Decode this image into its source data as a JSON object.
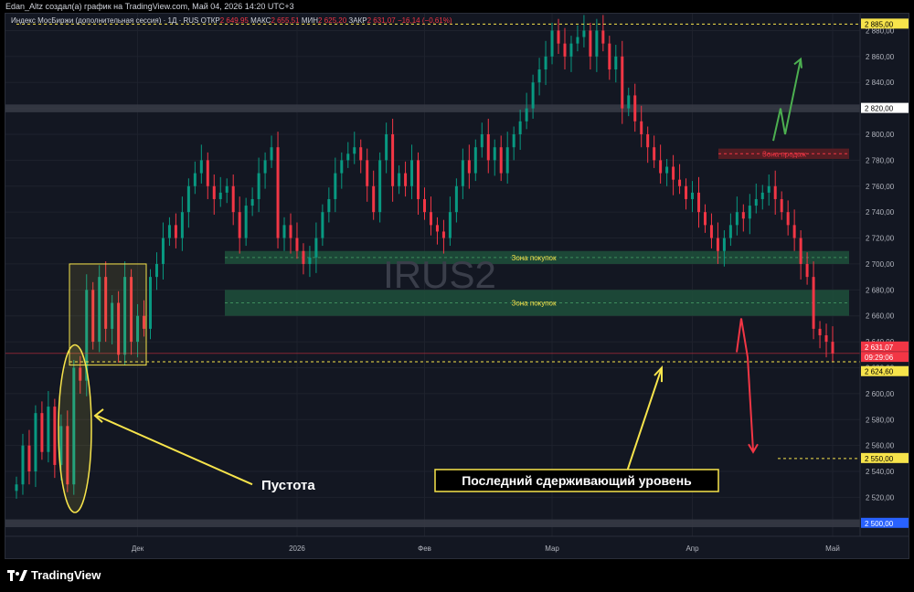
{
  "header": {
    "text": "Edan_Altz создал(а) график на TradingView.com, Май 04, 2026 14:20 UTC+3"
  },
  "legend": {
    "title": "Индекс МосБиржи (дополнительная сессия) · 1Д · RUS",
    "o_label": "ОТКР",
    "o_value": "2 649,95",
    "h_label": "МАКС",
    "h_value": "2 655,51",
    "l_label": "МИН",
    "l_value": "2 625,20",
    "c_label": "ЗАКР",
    "c_value": "2 631,07",
    "change": "−16,14 (−0,61%)"
  },
  "footer": {
    "brand": "TradingView"
  },
  "chart_data": {
    "type": "candlestick",
    "watermark": "IRUS2",
    "y_range": [
      2490,
      2893
    ],
    "y_ticks": [
      "2 880,00",
      "2 860,00",
      "2 840,00",
      "2 820,00",
      "2 800,00",
      "2 780,00",
      "2 760,00",
      "2 740,00",
      "2 720,00",
      "2 700,00",
      "2 680,00",
      "2 660,00",
      "2 640,00",
      "2 620,00",
      "2 600,00",
      "2 580,00",
      "2 560,00",
      "2 540,00",
      "2 520,00",
      "2 500,00"
    ],
    "x_labels": [
      {
        "label": "Дек",
        "idx": 19
      },
      {
        "label": "2026",
        "idx": 44
      },
      {
        "label": "Фев",
        "idx": 64
      },
      {
        "label": "Мар",
        "idx": 84
      },
      {
        "label": "Апр",
        "idx": 106
      },
      {
        "label": "Май",
        "idx": 128
      }
    ],
    "candles": [
      2530,
      2560,
      2540,
      2585,
      2555,
      2590,
      2545,
      2575,
      2530,
      2620,
      2610,
      2680,
      2640,
      2690,
      2650,
      2670,
      2630,
      2690,
      2640,
      2660,
      2650,
      2690,
      2700,
      2720,
      2730,
      2720,
      2740,
      2760,
      2770,
      2780,
      2760,
      2750,
      2755,
      2760,
      2740,
      2720,
      2745,
      2750,
      2770,
      2780,
      2790,
      2720,
      2730,
      2720,
      2710,
      2700,
      2705,
      2720,
      2740,
      2750,
      2770,
      2780,
      2785,
      2790,
      2780,
      2760,
      2740,
      2780,
      2800,
      2760,
      2770,
      2760,
      2780,
      2750,
      2740,
      2730,
      2725,
      2720,
      2740,
      2760,
      2780,
      2770,
      2790,
      2800,
      2780,
      2790,
      2770,
      2790,
      2800,
      2810,
      2820,
      2840,
      2850,
      2860,
      2880,
      2870,
      2860,
      2870,
      2875,
      2880,
      2860,
      2880,
      2870,
      2850,
      2860,
      2820,
      2830,
      2810,
      2800,
      2790,
      2780,
      2770,
      2775,
      2765,
      2760,
      2750,
      2755,
      2740,
      2730,
      2720,
      2710,
      2720,
      2730,
      2740,
      2735,
      2745,
      2750,
      2755,
      2760,
      2750,
      2740,
      2730,
      2720,
      2700,
      2690,
      2650,
      2645,
      2640,
      2631
    ],
    "price_labels": [
      {
        "text": "2 885,00",
        "value": 2885,
        "bg": "#f7e44b",
        "fg": "#000000"
      },
      {
        "text": "2 820,00",
        "value": 2820,
        "bg": "#ffffff",
        "fg": "#000000"
      },
      {
        "text": "2 631,07",
        "value": 2636,
        "bg": "#f23645",
        "fg": "#ffffff"
      },
      {
        "text": "09:29:06",
        "value": 2628,
        "bg": "#f23645",
        "fg": "#ffffff"
      },
      {
        "text": "2 624,60",
        "value": 2617,
        "bg": "#f7e44b",
        "fg": "#000000"
      },
      {
        "text": "2 550,00",
        "value": 2550,
        "bg": "#f7e44b",
        "fg": "#000000"
      },
      {
        "text": "2 500,00",
        "value": 2500,
        "bg": "#2962ff",
        "fg": "#ffffff"
      }
    ],
    "annotations": {
      "buy_zone": "Зона покупок",
      "sell_zone": "Зона продаж",
      "void": "Пустота",
      "last_level": "Последний сдерживающий уровень"
    },
    "colors": {
      "up": "#089981",
      "down": "#f23645",
      "zone_buy": "#1e4d3a",
      "zone_sell": "#5a1e24",
      "yellow": "#f7e44b"
    }
  }
}
